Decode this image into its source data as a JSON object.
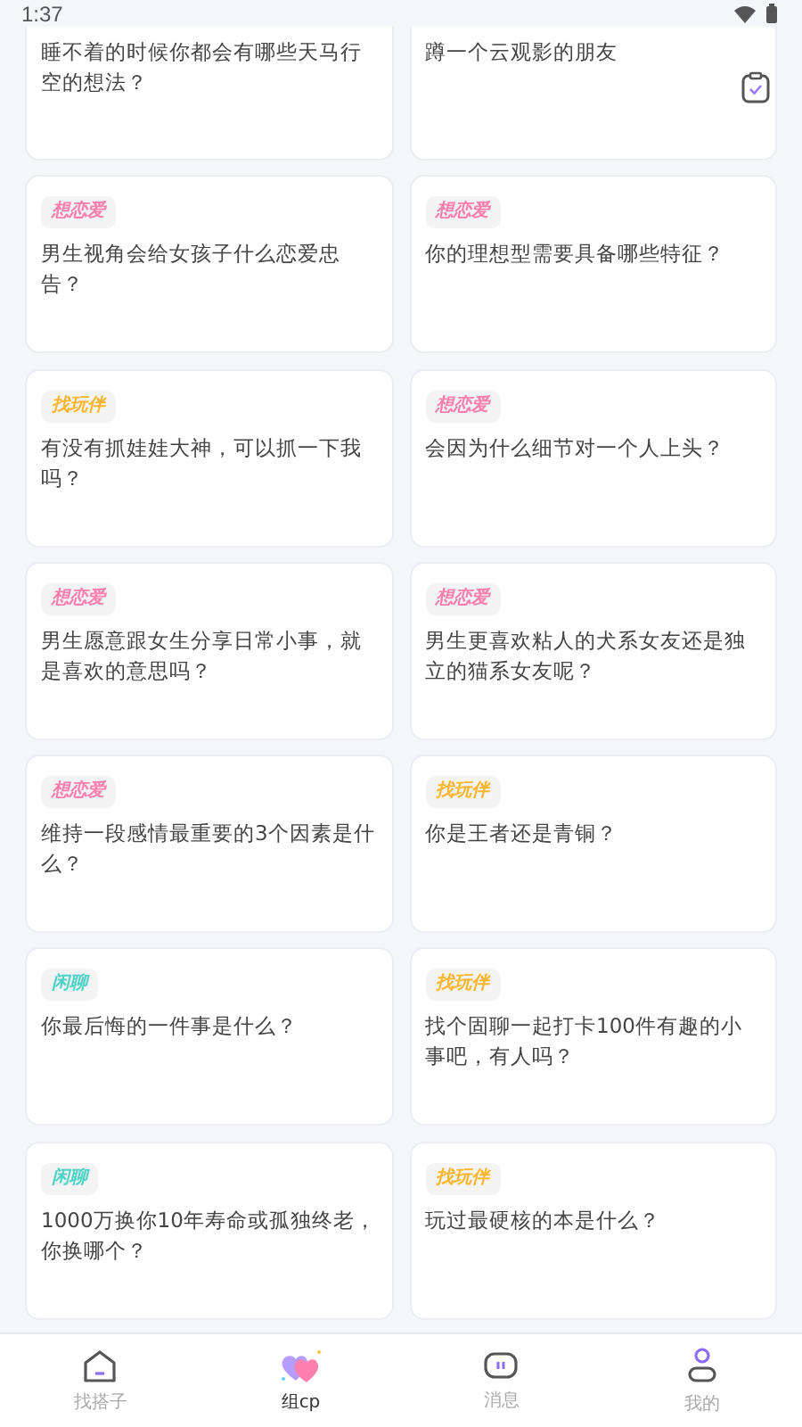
{
  "status_bar": {
    "time": "1:37"
  },
  "cards": [
    {
      "text": "睡不着的时候你都会有哪些天马行空的想法？"
    },
    {
      "text": "蹲一个云观影的朋友"
    },
    {
      "tag": {
        "label": "想恋爱",
        "color": "#ff7fae"
      },
      "text": "男生视角会给女孩子什么恋爱忠告？"
    },
    {
      "tag": {
        "label": "想恋爱",
        "color": "#ff7fae"
      },
      "text": "你的理想型需要具备哪些特征？"
    },
    {
      "tag": {
        "label": "找玩伴",
        "color": "#ffb62e"
      },
      "text": "有没有抓娃娃大神，可以抓一下我吗？"
    },
    {
      "tag": {
        "label": "想恋爱",
        "color": "#ff7fae"
      },
      "text": "会因为什么细节对一个人上头？"
    },
    {
      "tag": {
        "label": "想恋爱",
        "color": "#ff7fae"
      },
      "text": "男生愿意跟女生分享日常小事，就是喜欢的意思吗？"
    },
    {
      "tag": {
        "label": "想恋爱",
        "color": "#ff7fae"
      },
      "text": "男生更喜欢粘人的犬系女友还是独立的猫系女友呢？"
    },
    {
      "tag": {
        "label": "想恋爱",
        "color": "#ff7fae"
      },
      "text": "维持一段感情最重要的3个因素是什么？"
    },
    {
      "tag": {
        "label": "找玩伴",
        "color": "#ffb62e"
      },
      "text": "你是王者还是青铜？"
    },
    {
      "tag": {
        "label": "闲聊",
        "color": "#4fd3c6"
      },
      "text": "你最后悔的一件事是什么？"
    },
    {
      "tag": {
        "label": "找玩伴",
        "color": "#ffb62e"
      },
      "text": "找个固聊一起打卡100件有趣的小事吧，有人吗？"
    },
    {
      "tag": {
        "label": "闲聊",
        "color": "#4fd3c6"
      },
      "text": "1000万换你10年寿命或孤独终老，你换哪个？"
    },
    {
      "tag": {
        "label": "找玩伴",
        "color": "#ffb62e"
      },
      "text": "玩过最硬核的本是什么？"
    }
  ],
  "nav": [
    {
      "kind": "home",
      "label": "找搭子",
      "selected": false
    },
    {
      "kind": "hearts",
      "label": "组cp",
      "selected": true
    },
    {
      "kind": "message",
      "label": "消息",
      "selected": false
    },
    {
      "kind": "profile",
      "label": "我的",
      "selected": false
    }
  ]
}
